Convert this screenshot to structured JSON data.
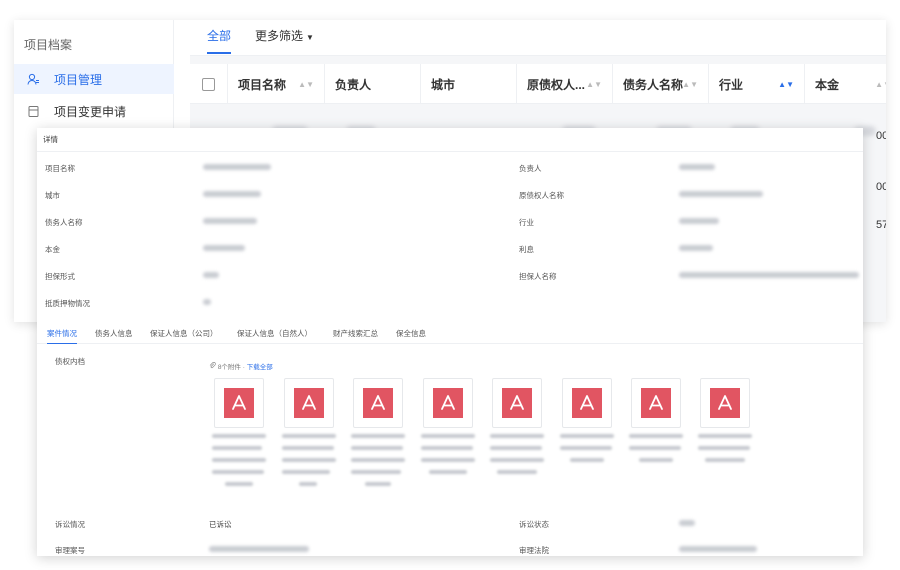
{
  "sidebar": {
    "title": "项目档案",
    "items": [
      {
        "label": "项目管理",
        "icon": "user-group-icon",
        "active": true
      },
      {
        "label": "项目变更申请",
        "icon": "document-icon",
        "active": false
      }
    ]
  },
  "list": {
    "tabs": [
      {
        "label": "全部",
        "active": true
      },
      {
        "label": "更多筛选",
        "dropdown": true
      }
    ],
    "columns": [
      "项目名称",
      "负责人",
      "城市",
      "原债权人...",
      "债务人名称",
      "行业",
      "本金"
    ],
    "partial_values": [
      "00",
      "00",
      "57"
    ]
  },
  "detail": {
    "title": "详情",
    "fields_left": [
      {
        "label": "项目名称"
      },
      {
        "label": "城市"
      },
      {
        "label": "债务人名称"
      },
      {
        "label": "本金"
      },
      {
        "label": "担保形式"
      },
      {
        "label": "抵质押物情况"
      }
    ],
    "fields_right": [
      {
        "label": "负责人"
      },
      {
        "label": "原债权人名称"
      },
      {
        "label": "行业"
      },
      {
        "label": "利息"
      },
      {
        "label": "担保人名称"
      }
    ],
    "tabs": [
      "案件情况",
      "债务人信息",
      "保证人信息（公司）",
      "保证人信息（自然人）",
      "财产线索汇总",
      "保全信息"
    ],
    "case": {
      "claim_label": "债权内档",
      "attach_count": "8个附件",
      "download_all": "下载全部",
      "litigation_label": "诉讼情况",
      "litigation_value": "已诉讼",
      "litigation_status_label": "诉讼状态",
      "case_no_label": "审理案号",
      "court_label": "审理法院"
    },
    "attachment_count_visible": 8
  },
  "colors": {
    "accent": "#2a6ee8",
    "pdf": "#e15562"
  }
}
